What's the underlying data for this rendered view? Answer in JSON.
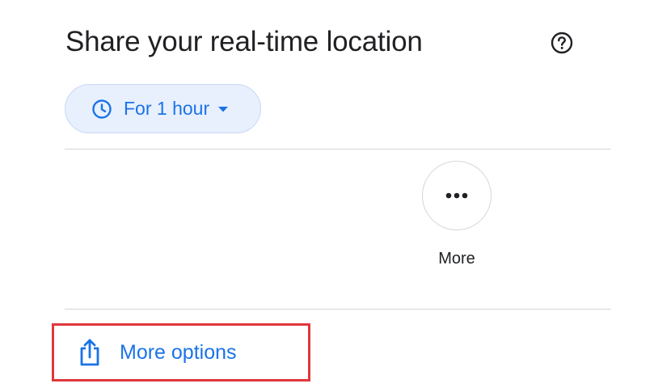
{
  "header": {
    "title": "Share your real-time location",
    "help_icon": "help-circle-icon"
  },
  "duration": {
    "label": "For 1 hour",
    "icon": "clock-icon",
    "caret_icon": "caret-down-icon",
    "accent": "#1a73e8",
    "chip_background": "#e8f0fe"
  },
  "share_targets": [
    {
      "label": "More",
      "icon": "more-horizontal-icon"
    }
  ],
  "footer": {
    "more_options_label": "More options",
    "icon": "share-upload-icon",
    "highlight_color": "#e0373c"
  }
}
